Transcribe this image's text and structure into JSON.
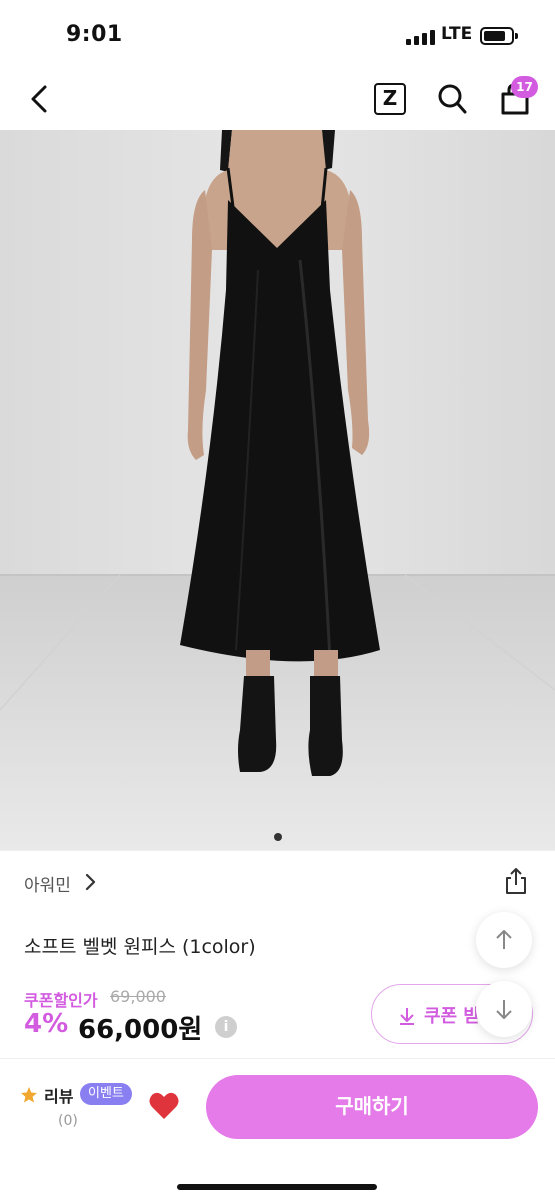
{
  "status_bar": {
    "time": "9:01",
    "network": "LTE"
  },
  "nav": {
    "z_label": "Z",
    "cart_count": "17"
  },
  "carousel": {
    "total": 1,
    "active": 0
  },
  "brand": {
    "name": "아워민"
  },
  "product": {
    "title": "소프트 벨벳 원피스 (1color)"
  },
  "price": {
    "coupon_label": "쿠폰할인가",
    "original": "69,000",
    "discount_rate": "4%",
    "sale": "66,000원",
    "info_symbol": "i"
  },
  "coupon_button": {
    "label": "쿠폰 받"
  },
  "bottom_bar": {
    "review_label": "리뷰",
    "event_badge": "이벤트",
    "review_count": "(0)",
    "buy_label": "구매하기"
  },
  "colors": {
    "accent": "#d25be0",
    "buy_button": "#e57be9",
    "event_badge": "#8a7ff0"
  },
  "icons": [
    "back-icon",
    "z-icon",
    "search-icon",
    "shopping-bag-icon",
    "share-icon",
    "chevron-right-icon",
    "arrow-up-icon",
    "arrow-down-icon",
    "download-icon",
    "star-icon",
    "heart-icon",
    "info-icon"
  ]
}
